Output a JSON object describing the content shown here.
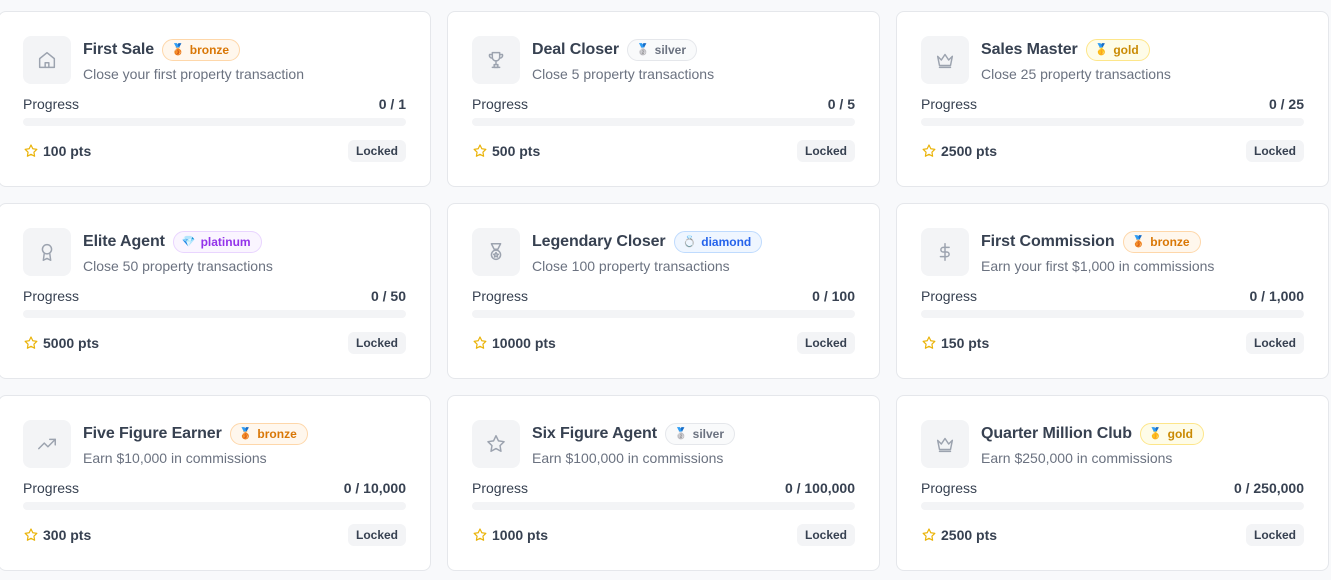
{
  "achievements": [
    {
      "icon": "house-icon",
      "title": "First Sale",
      "tier": "bronze",
      "tier_icon": "bronze-medal-icon",
      "description": "Close your first property transaction",
      "progress_label": "Progress",
      "progress": "0 / 1",
      "progress_fraction": 0,
      "points": "100 pts",
      "status": "Locked"
    },
    {
      "icon": "trophy-icon",
      "title": "Deal Closer",
      "tier": "silver",
      "tier_icon": "silver-medal-icon",
      "description": "Close 5 property transactions",
      "progress_label": "Progress",
      "progress": "0 / 5",
      "progress_fraction": 0,
      "points": "500 pts",
      "status": "Locked"
    },
    {
      "icon": "crown-icon",
      "title": "Sales Master",
      "tier": "gold",
      "tier_icon": "gold-medal-icon",
      "description": "Close 25 property transactions",
      "progress_label": "Progress",
      "progress": "0 / 25",
      "progress_fraction": 0,
      "points": "2500 pts",
      "status": "Locked"
    },
    {
      "icon": "award-ribbon-icon",
      "title": "Elite Agent",
      "tier": "platinum",
      "tier_icon": "gem-icon",
      "description": "Close 50 property transactions",
      "progress_label": "Progress",
      "progress": "0 / 50",
      "progress_fraction": 0,
      "points": "5000 pts",
      "status": "Locked"
    },
    {
      "icon": "medal-icon",
      "title": "Legendary Closer",
      "tier": "diamond",
      "tier_icon": "diamond-ring-icon",
      "description": "Close 100 property transactions",
      "progress_label": "Progress",
      "progress": "0 / 100",
      "progress_fraction": 0,
      "points": "10000 pts",
      "status": "Locked"
    },
    {
      "icon": "dollar-sign-icon",
      "title": "First Commission",
      "tier": "bronze",
      "tier_icon": "bronze-medal-icon",
      "description": "Earn your first $1,000 in commissions",
      "progress_label": "Progress",
      "progress": "0 / 1,000",
      "progress_fraction": 0,
      "points": "150 pts",
      "status": "Locked"
    },
    {
      "icon": "trending-up-icon",
      "title": "Five Figure Earner",
      "tier": "bronze",
      "tier_icon": "bronze-medal-icon",
      "description": "Earn $10,000 in commissions",
      "progress_label": "Progress",
      "progress": "0 / 10,000",
      "progress_fraction": 0,
      "points": "300 pts",
      "status": "Locked"
    },
    {
      "icon": "star-icon",
      "title": "Six Figure Agent",
      "tier": "silver",
      "tier_icon": "silver-medal-icon",
      "description": "Earn $100,000 in commissions",
      "progress_label": "Progress",
      "progress": "0 / 100,000",
      "progress_fraction": 0,
      "points": "1000 pts",
      "status": "Locked"
    },
    {
      "icon": "crown-icon",
      "title": "Quarter Million Club",
      "tier": "gold",
      "tier_icon": "gold-medal-icon",
      "description": "Earn $250,000 in commissions",
      "progress_label": "Progress",
      "progress": "0 / 250,000",
      "progress_fraction": 0,
      "points": "2500 pts",
      "status": "Locked"
    }
  ],
  "colors": {
    "bronze": "#d97706",
    "silver": "#6b7280",
    "gold": "#ca8a04",
    "platinum": "#9333ea",
    "diamond": "#2563eb",
    "points_star": "#eab308"
  }
}
